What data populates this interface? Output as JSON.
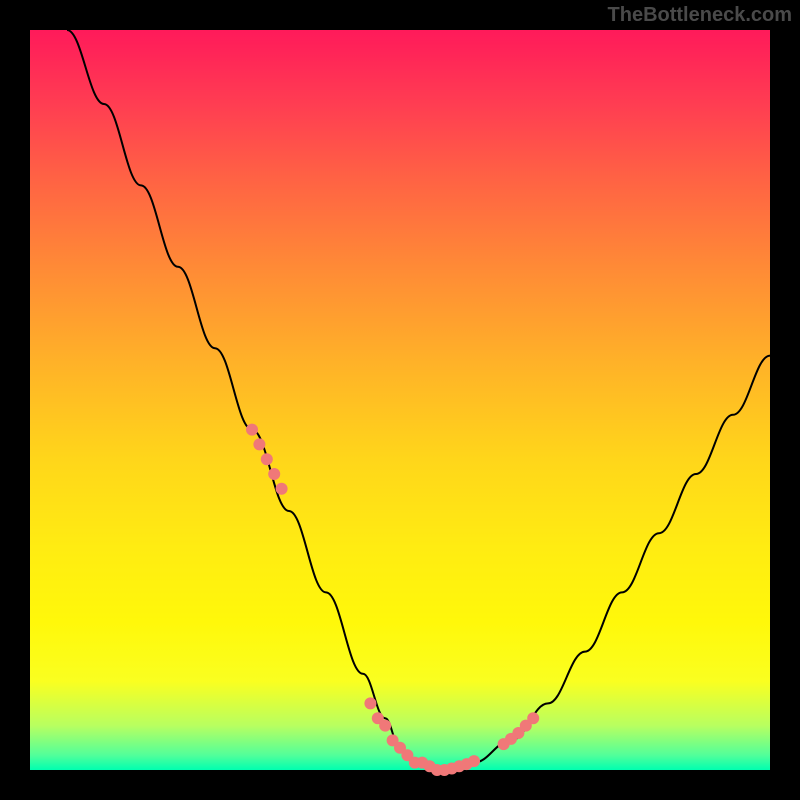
{
  "watermark": "TheBottleneck.com",
  "chart_data": {
    "type": "line",
    "title": "",
    "xlabel": "",
    "ylabel": "",
    "x_range": [
      0,
      100
    ],
    "y_range": [
      0,
      100
    ],
    "series": [
      {
        "name": "bottleneck-curve",
        "color": "#000000",
        "x": [
          5,
          10,
          15,
          20,
          25,
          30,
          35,
          40,
          45,
          48,
          50,
          52,
          55,
          58,
          60,
          65,
          70,
          75,
          80,
          85,
          90,
          95,
          100
        ],
        "y": [
          100,
          90,
          79,
          68,
          57,
          46,
          35,
          24,
          13,
          7,
          3,
          1,
          0,
          0,
          1,
          4,
          9,
          16,
          24,
          32,
          40,
          48,
          56
        ]
      }
    ],
    "markers": {
      "name": "highlight-points",
      "color": "#f07878",
      "x": [
        30,
        31,
        32,
        33,
        34,
        46,
        47,
        48,
        49,
        50,
        51,
        52,
        53,
        54,
        55,
        56,
        57,
        58,
        59,
        60,
        64,
        65,
        66,
        67,
        68
      ],
      "y": [
        46,
        44,
        42,
        40,
        38,
        9,
        7,
        6,
        4,
        3,
        2,
        1,
        1,
        0.5,
        0,
        0,
        0.2,
        0.5,
        0.8,
        1.2,
        3.5,
        4.2,
        5,
        6,
        7
      ]
    },
    "background_gradient": {
      "top": "#ff1a5a",
      "bottom": "#00ffb0"
    }
  }
}
